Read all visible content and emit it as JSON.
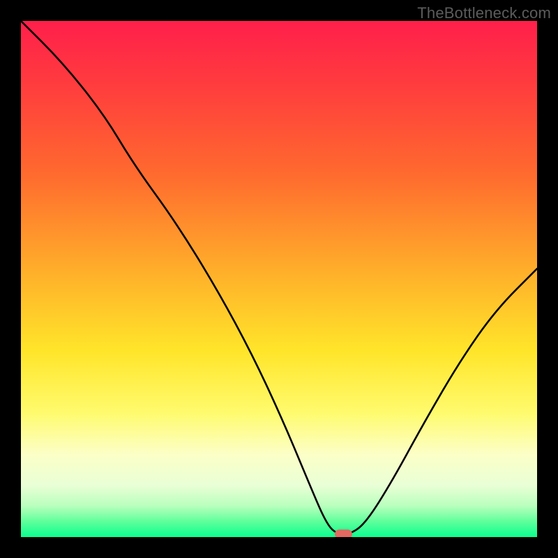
{
  "attribution": "TheBottleneck.com",
  "colors": {
    "page_bg": "#000000",
    "curve": "#000000",
    "marker_fill": "#e26a60",
    "marker_stroke": "#e26a60",
    "attribution_text": "#5c5c5c",
    "gradient_stops": [
      {
        "pos": 0,
        "hex": "#ff1f4b"
      },
      {
        "pos": 12,
        "hex": "#ff3b3e"
      },
      {
        "pos": 30,
        "hex": "#ff6b2e"
      },
      {
        "pos": 50,
        "hex": "#ffb42a"
      },
      {
        "pos": 64,
        "hex": "#ffe52a"
      },
      {
        "pos": 76,
        "hex": "#fffb6e"
      },
      {
        "pos": 84,
        "hex": "#fcffc7"
      },
      {
        "pos": 90,
        "hex": "#e9ffd6"
      },
      {
        "pos": 94,
        "hex": "#b8ffbd"
      },
      {
        "pos": 97,
        "hex": "#5eff9b"
      },
      {
        "pos": 100,
        "hex": "#0aff8e"
      }
    ]
  },
  "chart_data": {
    "type": "line",
    "title": "",
    "xlabel": "",
    "ylabel": "",
    "x_range": [
      0,
      100
    ],
    "y_range": [
      0,
      100
    ],
    "note": "Gradient heat background runs red (top, y≈100 = high bottleneck) to green (bottom, y≈0 = no bottleneck). Curve is a V-shape touching y≈0 near x≈62. Values are estimated from pixels (no axis labels present).",
    "series": [
      {
        "name": "bottleneck-curve",
        "points": [
          {
            "x": 0,
            "y": 100
          },
          {
            "x": 8,
            "y": 92
          },
          {
            "x": 16,
            "y": 82
          },
          {
            "x": 22,
            "y": 72
          },
          {
            "x": 30,
            "y": 61
          },
          {
            "x": 38,
            "y": 48
          },
          {
            "x": 45,
            "y": 35
          },
          {
            "x": 51,
            "y": 22
          },
          {
            "x": 56,
            "y": 10
          },
          {
            "x": 59,
            "y": 3
          },
          {
            "x": 61,
            "y": 0.6
          },
          {
            "x": 64,
            "y": 0.6
          },
          {
            "x": 67,
            "y": 3
          },
          {
            "x": 72,
            "y": 11
          },
          {
            "x": 78,
            "y": 22
          },
          {
            "x": 85,
            "y": 34
          },
          {
            "x": 92,
            "y": 44
          },
          {
            "x": 100,
            "y": 52
          }
        ]
      }
    ],
    "marker": {
      "x": 62.5,
      "y": 0.6,
      "shape": "rounded-rect"
    }
  }
}
